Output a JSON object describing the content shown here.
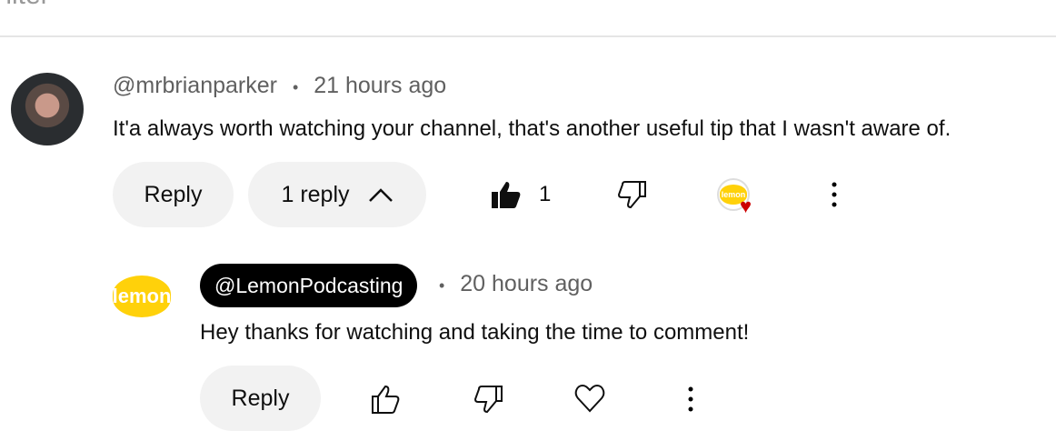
{
  "filter_label": "Filter",
  "comment": {
    "author": "@mrbrianparker",
    "time": "21 hours ago",
    "text": "It'a always worth watching your channel, that's another useful tip that I wasn't aware of.",
    "reply_label": "Reply",
    "replies_label": "1 reply",
    "like_count": "1",
    "creator_heart_logo": "lemon"
  },
  "reply": {
    "author": "@LemonPodcasting",
    "time": "20 hours ago",
    "text": "Hey thanks for watching and taking the time to comment!",
    "reply_label": "Reply",
    "logo_text": "lemon"
  }
}
